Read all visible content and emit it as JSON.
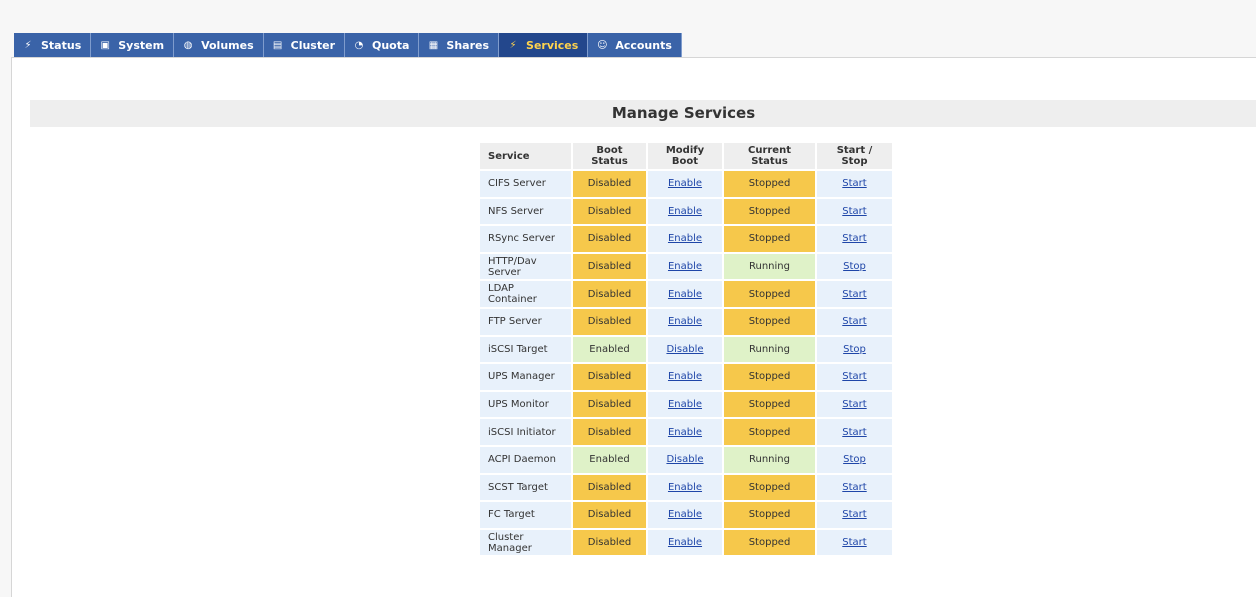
{
  "tabs": [
    {
      "label": "Status",
      "icon": "status-icon",
      "active": false
    },
    {
      "label": "System",
      "icon": "system-icon",
      "active": false
    },
    {
      "label": "Volumes",
      "icon": "volumes-icon",
      "active": false
    },
    {
      "label": "Cluster",
      "icon": "cluster-icon",
      "active": false
    },
    {
      "label": "Quota",
      "icon": "quota-icon",
      "active": false
    },
    {
      "label": "Shares",
      "icon": "shares-icon",
      "active": false
    },
    {
      "label": "Services",
      "icon": "services-icon",
      "active": true
    },
    {
      "label": "Accounts",
      "icon": "accounts-icon",
      "active": false
    }
  ],
  "page": {
    "title": "Manage Services"
  },
  "table": {
    "headers": [
      "Service",
      "Boot Status",
      "Modify Boot",
      "Current Status",
      "Start / Stop"
    ],
    "rows": [
      {
        "service": "CIFS Server",
        "boot": "Disabled",
        "modify": "Enable",
        "current": "Stopped",
        "action": "Start"
      },
      {
        "service": "NFS Server",
        "boot": "Disabled",
        "modify": "Enable",
        "current": "Stopped",
        "action": "Start"
      },
      {
        "service": "RSync Server",
        "boot": "Disabled",
        "modify": "Enable",
        "current": "Stopped",
        "action": "Start"
      },
      {
        "service": "HTTP/Dav Server",
        "boot": "Disabled",
        "modify": "Enable",
        "current": "Running",
        "action": "Stop"
      },
      {
        "service": "LDAP Container",
        "boot": "Disabled",
        "modify": "Enable",
        "current": "Stopped",
        "action": "Start"
      },
      {
        "service": "FTP Server",
        "boot": "Disabled",
        "modify": "Enable",
        "current": "Stopped",
        "action": "Start"
      },
      {
        "service": "iSCSI Target",
        "boot": "Enabled",
        "modify": "Disable",
        "current": "Running",
        "action": "Stop"
      },
      {
        "service": "UPS Manager",
        "boot": "Disabled",
        "modify": "Enable",
        "current": "Stopped",
        "action": "Start"
      },
      {
        "service": "UPS Monitor",
        "boot": "Disabled",
        "modify": "Enable",
        "current": "Stopped",
        "action": "Start"
      },
      {
        "service": "iSCSI Initiator",
        "boot": "Disabled",
        "modify": "Enable",
        "current": "Stopped",
        "action": "Start"
      },
      {
        "service": "ACPI Daemon",
        "boot": "Enabled",
        "modify": "Disable",
        "current": "Running",
        "action": "Stop"
      },
      {
        "service": "SCST Target",
        "boot": "Disabled",
        "modify": "Enable",
        "current": "Stopped",
        "action": "Start"
      },
      {
        "service": "FC Target",
        "boot": "Disabled",
        "modify": "Enable",
        "current": "Stopped",
        "action": "Start"
      },
      {
        "service": "Cluster Manager",
        "boot": "Disabled",
        "modify": "Enable",
        "current": "Stopped",
        "action": "Start"
      }
    ]
  },
  "colors": {
    "tab_bg": "#3a63a8",
    "tab_active_bg": "#23478c",
    "tab_active_text": "#ffd34d",
    "disabled_stopped": "#f6c84b",
    "enabled_running": "#dff2c8",
    "link": "#1f46a8"
  }
}
